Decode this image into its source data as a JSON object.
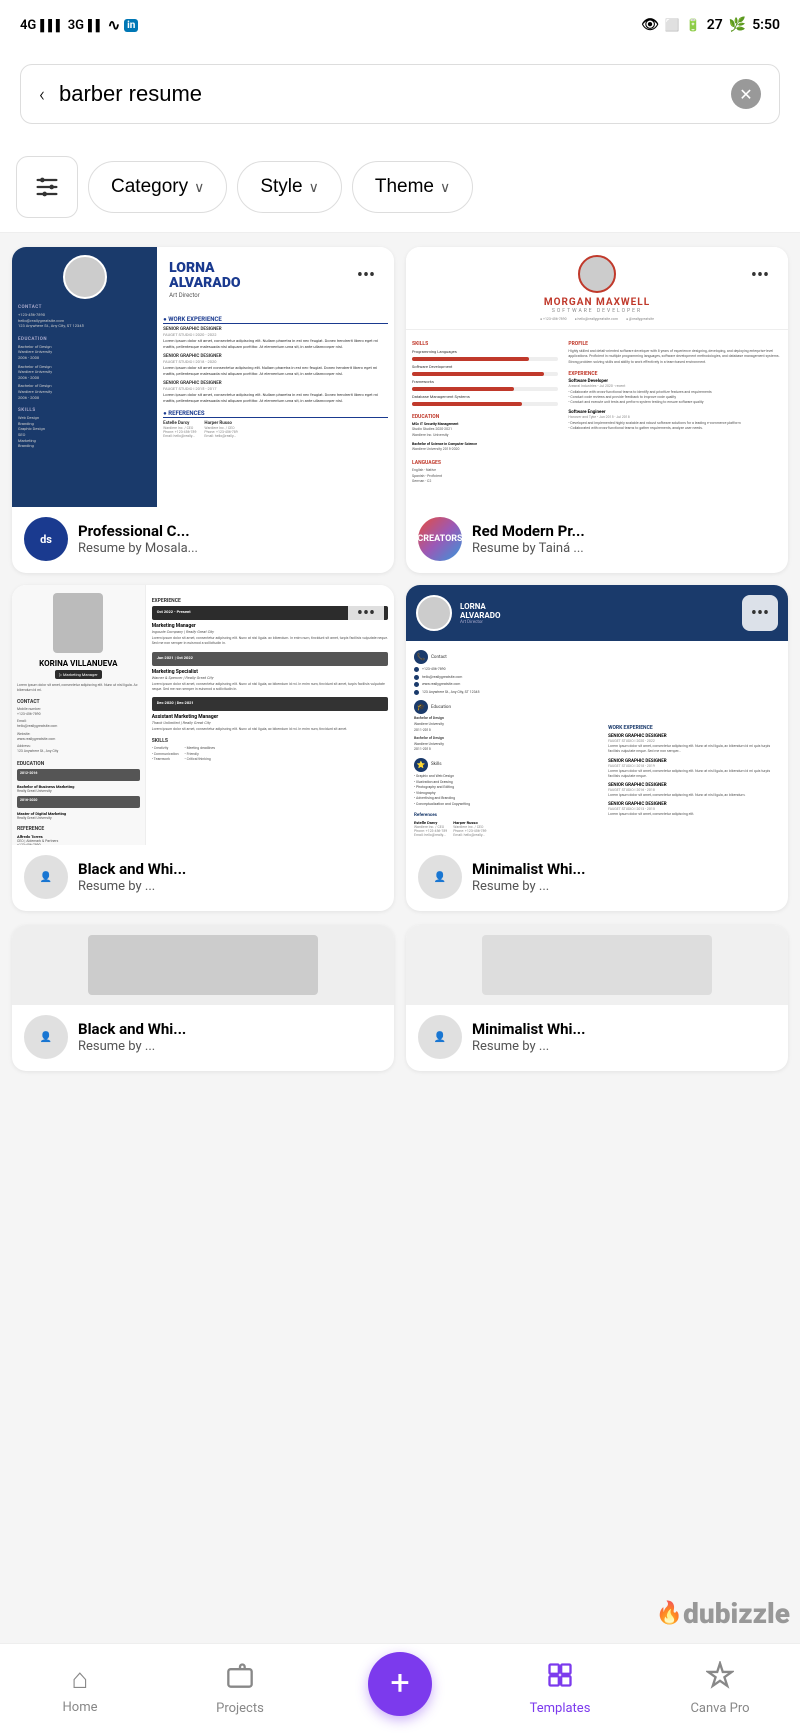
{
  "status": {
    "left": "4G 3G",
    "wifi": "WiFi",
    "linkedin": "in",
    "eye_icon": "👁",
    "battery": "27",
    "time": "5:50"
  },
  "search": {
    "query": "barber resume",
    "placeholder": "barber resume",
    "back_label": "‹",
    "clear_label": "✕"
  },
  "filters": {
    "filter_icon_label": "⊞",
    "category_label": "Category",
    "style_label": "Style",
    "theme_label": "Theme",
    "chevron": "∨"
  },
  "cards": [
    {
      "id": "card1",
      "title": "Professional C...",
      "subtitle": "Resume by Mosala...",
      "avatar_type": "ds",
      "avatar_label": "ds"
    },
    {
      "id": "card2",
      "title": "Red Modern Pr...",
      "subtitle": "Resume by Tainá ...",
      "avatar_type": "creators",
      "avatar_label": "CREATORS"
    },
    {
      "id": "card3",
      "title": "Black and Whi...",
      "subtitle": "Resume by ...",
      "avatar_type": "generic",
      "avatar_label": ""
    },
    {
      "id": "card4",
      "title": "Minimalist Whi...",
      "subtitle": "Resume by ...",
      "avatar_type": "generic",
      "avatar_label": ""
    }
  ],
  "nav": {
    "home_label": "Home",
    "projects_label": "Projects",
    "add_label": "+",
    "templates_label": "Templates",
    "canva_pro_label": "Canva Pro"
  },
  "watermark": {
    "text": "dubizzle",
    "flame": "🔥"
  }
}
